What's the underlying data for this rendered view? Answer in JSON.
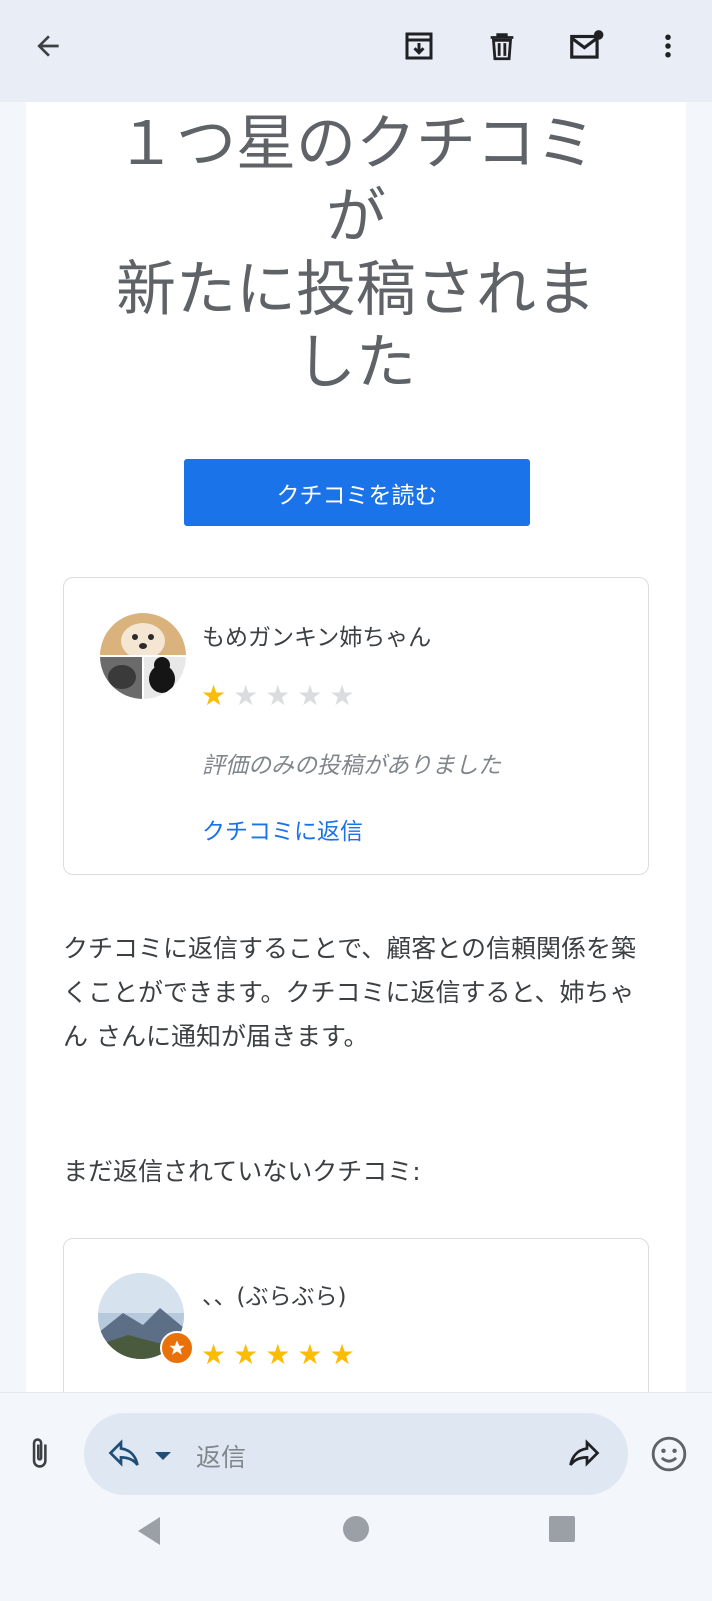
{
  "toolbar": {
    "icons": [
      "back-arrow-icon",
      "archive-icon",
      "delete-icon",
      "mark-unread-icon",
      "more-vert-icon"
    ]
  },
  "email": {
    "headline_lines": [
      "１つ星のクチコミ",
      "が",
      "新たに投稿されま",
      "した"
    ],
    "read_button": "クチコミを読む",
    "review1": {
      "reviewer": "もめガンキン姉ちゃん",
      "rating": 1,
      "max_rating": 5,
      "note": "評価のみの投稿がありました",
      "reply_link": "クチコミに返信"
    },
    "paragraph": "クチコミに返信することで、顧客との信頼関係を築くことができます。クチコミに返信すると、姉ちゃん さんに通知が届きます。",
    "unreplied_label": "まだ返信されていないクチコミ:",
    "review2": {
      "reviewer": "、、(ぶらぶら)",
      "rating": 5,
      "max_rating": 5
    }
  },
  "compose": {
    "placeholder": "返信"
  },
  "colors": {
    "accent": "#1a73e8",
    "star": "#fbbc04",
    "toolbar_bg": "#e9eef6"
  }
}
